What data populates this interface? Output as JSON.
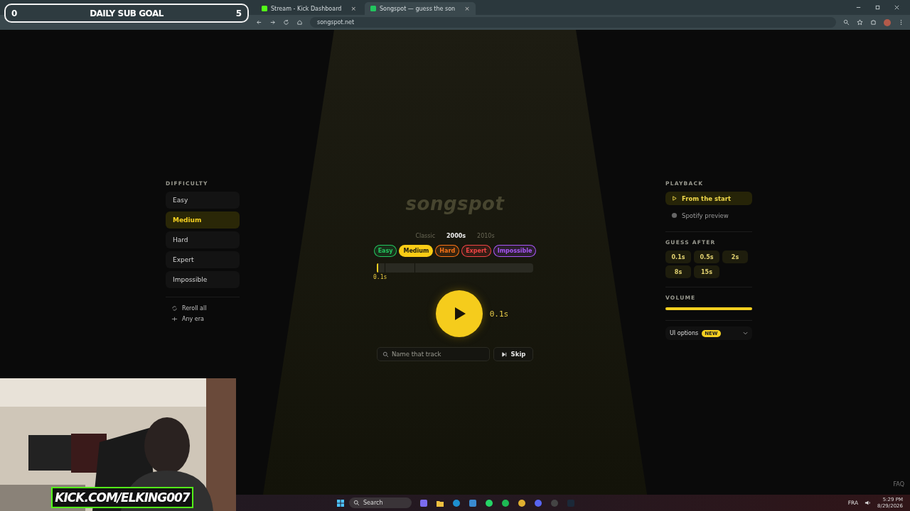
{
  "browser": {
    "tabs": [
      {
        "title": "Stream - Kick Dashboard",
        "close": "×",
        "selected": false
      },
      {
        "title": "Songspot — guess the son",
        "close": "×",
        "selected": true
      }
    ],
    "url": "songspot.net"
  },
  "sub_goal": {
    "current": "0",
    "label": "DAILY SUB GOAL",
    "target": "5"
  },
  "difficulty": {
    "heading": "DIFFICULTY",
    "options": [
      {
        "label": "Easy",
        "selected": false
      },
      {
        "label": "Medium",
        "selected": true
      },
      {
        "label": "Hard",
        "selected": false
      },
      {
        "label": "Expert",
        "selected": false
      },
      {
        "label": "Impossible",
        "selected": false
      }
    ],
    "actions": [
      {
        "label": "Reroll all",
        "kind": "reroll"
      },
      {
        "label": "Any era",
        "kind": "era"
      }
    ]
  },
  "game": {
    "logo": "songspot",
    "eras": [
      {
        "label": "Classic",
        "selected": false
      },
      {
        "label": "2000s",
        "selected": true
      },
      {
        "label": "2010s",
        "selected": false
      }
    ],
    "chips": [
      {
        "label": "Easy",
        "color": "#22c55e",
        "selected": false
      },
      {
        "label": "Medium",
        "color": "#facc15",
        "selected": true
      },
      {
        "label": "Hard",
        "color": "#f97316",
        "selected": false
      },
      {
        "label": "Expert",
        "color": "#ef4444",
        "selected": false
      },
      {
        "label": "Impossible",
        "color": "#a855f7",
        "selected": false
      }
    ],
    "progress": {
      "level": 0.01,
      "marker": "0.1s"
    },
    "play_time": "0.1s",
    "search": {
      "placeholder": "Name that track"
    },
    "skip": "Skip"
  },
  "playback": {
    "heading": "PLAYBACK",
    "options": [
      {
        "label": "From the start",
        "kind": "start",
        "selected": true
      },
      {
        "label": "Spotify preview",
        "kind": "spotify",
        "selected": false
      }
    ]
  },
  "guess_after": {
    "heading": "GUESS AFTER",
    "options": [
      "0.1s",
      "0.5s",
      "2s",
      "8s",
      "15s"
    ]
  },
  "volume": {
    "heading": "VOLUME",
    "level": 1.0
  },
  "ui_options": {
    "label": "UI options",
    "badge": "NEW"
  },
  "faq": "FAQ",
  "stream_banner": "KICK.COM/ELKING007",
  "taskbar": {
    "search": "Search",
    "language": "FRA",
    "time": "5:29 PM",
    "date": "8/29/2026"
  }
}
